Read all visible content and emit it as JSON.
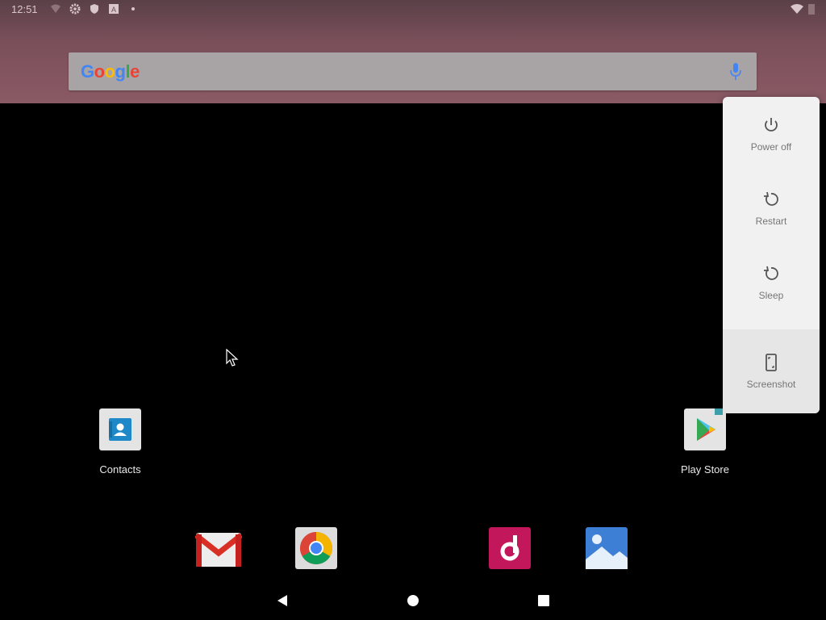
{
  "status_bar": {
    "time": "12:51",
    "icons": [
      "vpn-icon",
      "settings-icon",
      "shield-icon",
      "keyboard-a-icon",
      "dot-icon"
    ],
    "right_icons": [
      "wifi-icon",
      "battery-icon"
    ]
  },
  "search": {
    "logo_letters": [
      "G",
      "o",
      "o",
      "g",
      "l",
      "e"
    ],
    "mic_icon": "mic-icon"
  },
  "power_menu": {
    "items": [
      {
        "label": "Power off",
        "icon": "power-icon"
      },
      {
        "label": "Restart",
        "icon": "restart-icon"
      },
      {
        "label": "Sleep",
        "icon": "sleep-icon"
      },
      {
        "label": "Screenshot",
        "icon": "screenshot-icon"
      }
    ],
    "highlighted_index": 3
  },
  "home_apps": [
    {
      "label": "Contacts",
      "icon": "contacts-icon"
    },
    {
      "label": "Play Store",
      "icon": "play-store-icon"
    }
  ],
  "dock": [
    "gmail-icon",
    "chrome-icon",
    "music-icon",
    "gallery-icon"
  ],
  "nav": [
    "back-icon",
    "home-icon",
    "recents-icon"
  ],
  "colors": {
    "wallpaper": "#7a4f5a",
    "menu_bg": "#f1f1f1",
    "menu_text": "#767676"
  }
}
